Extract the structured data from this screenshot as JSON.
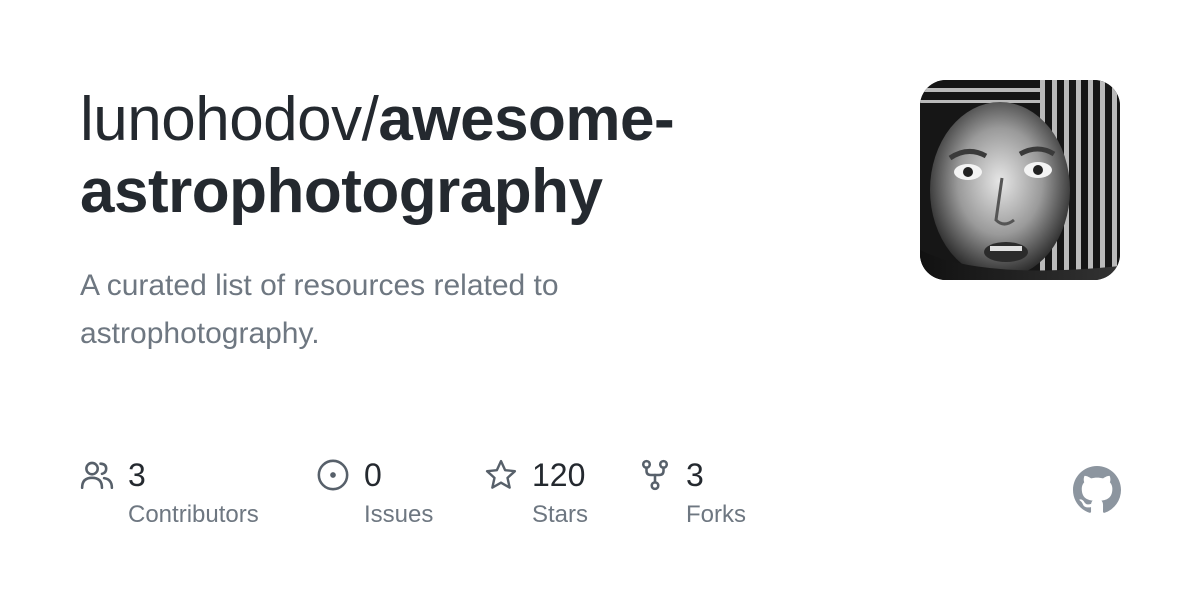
{
  "repo": {
    "owner": "lunohodov/",
    "name": "awesome-astrophotography",
    "description": "A curated list of resources related to astrophotography."
  },
  "stats": [
    {
      "icon": "contributors-icon",
      "value": "3",
      "label": "Contributors"
    },
    {
      "icon": "issues-icon",
      "value": "0",
      "label": "Issues"
    },
    {
      "icon": "star-icon",
      "value": "120",
      "label": "Stars"
    },
    {
      "icon": "fork-icon",
      "value": "3",
      "label": "Forks"
    }
  ],
  "colors": {
    "title": "#24292f",
    "muted": "#6e7781",
    "icon": "#57606a",
    "logo": "#8c959f"
  }
}
